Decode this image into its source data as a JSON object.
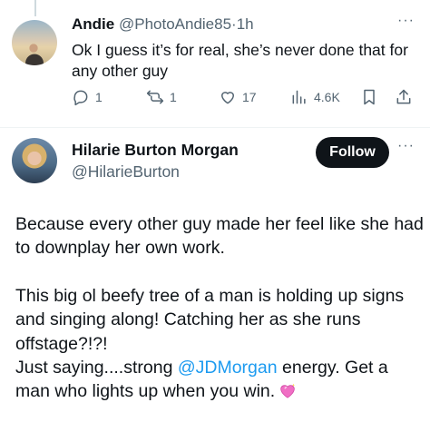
{
  "reply": {
    "author_name": "Andie",
    "handle": "@PhotoAndie85",
    "separator": "·",
    "time": "1h",
    "text": "Ok I guess it’s for real, she’s never done that for any other guy",
    "replies_count": "1",
    "reposts_count": "1",
    "likes_count": "17",
    "views_count": "4.6K",
    "more_label": "···"
  },
  "main": {
    "author_name": "Hilarie Burton Morgan",
    "handle": "@HilarieBurton",
    "follow_label": "Follow",
    "more_label": "···",
    "paragraph1": "Because every other guy made her feel like she had to downplay her own work.",
    "paragraph2_line1": "This big ol beefy tree of a man is holding up signs and singing along! Catching her as she runs offstage?!?!",
    "paragraph2_prefix": "Just saying....strong ",
    "mention": "@JDMorgan",
    "paragraph2_suffix": " energy. Get a man who lights up when you win.",
    "emoji_name": "sparkling-heart-icon"
  },
  "colors": {
    "text": "#0f1419",
    "secondary": "#536471",
    "link": "#1d9bf0",
    "button_bg": "#0f1419",
    "divider": "#eff3f4",
    "heart": "#f06ec4"
  }
}
